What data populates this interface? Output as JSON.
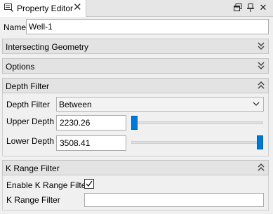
{
  "window": {
    "tab_title": "Property Editor",
    "tab_icon": "property-editor-icon",
    "buttons": [
      "close-icon",
      "restore-icon",
      "pin-icon",
      "close-icon"
    ]
  },
  "name": {
    "label": "Name",
    "value": "Well-1"
  },
  "groups": {
    "intersecting_geometry": {
      "title": "Intersecting Geometry",
      "expanded": false
    },
    "options": {
      "title": "Options",
      "expanded": false
    },
    "depth_filter": {
      "title": "Depth Filter",
      "expanded": true,
      "filter_label": "Depth Filter",
      "filter_value": "Between",
      "upper_label": "Upper Depth",
      "upper_value": "2230.26",
      "upper_slider": 0.0,
      "lower_label": "Lower Depth",
      "lower_value": "3508.41",
      "lower_slider": 1.0
    },
    "k_range_filter": {
      "title": "K Range Filter",
      "expanded": true,
      "enable_label": "Enable K Range Filter",
      "enable_checked": true,
      "range_label": "K Range Filter",
      "range_value": ""
    }
  },
  "colors": {
    "accent": "#0078d7"
  }
}
